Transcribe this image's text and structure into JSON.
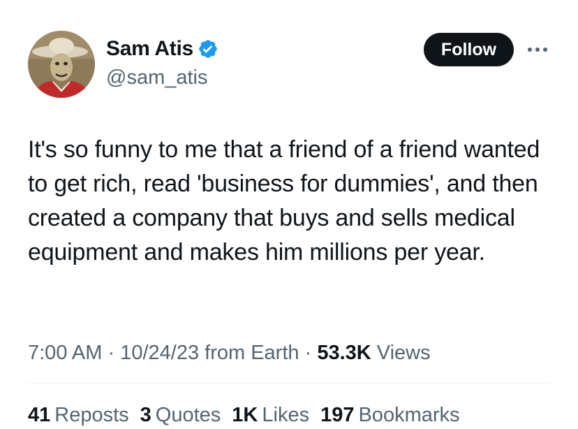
{
  "author": {
    "display_name": "Sam Atis",
    "handle": "@sam_atis",
    "verified": true,
    "avatar_icon": "avatar-portrait"
  },
  "actions": {
    "follow_label": "Follow",
    "more_icon": "more-horizontal-icon"
  },
  "tweet": {
    "text": "It's so funny to me that a friend of a friend wanted to get rich, read 'business for dummies', and then created a company that buys and sells medical equipment and makes him millions per year."
  },
  "meta": {
    "time": "7:00 AM",
    "separator": "·",
    "date": "10/24/23",
    "source": "from Earth",
    "views_count": "53.3K",
    "views_label": "Views"
  },
  "stats": [
    {
      "count": "41",
      "label": "Reposts"
    },
    {
      "count": "3",
      "label": "Quotes"
    },
    {
      "count": "1K",
      "label": "Likes"
    },
    {
      "count": "197",
      "label": "Bookmarks"
    }
  ],
  "colors": {
    "text_primary": "#0f1419",
    "text_secondary": "#536471",
    "verified_blue": "#1d9bf0",
    "follow_bg": "#0f1419",
    "divider": "#eff3f4"
  }
}
